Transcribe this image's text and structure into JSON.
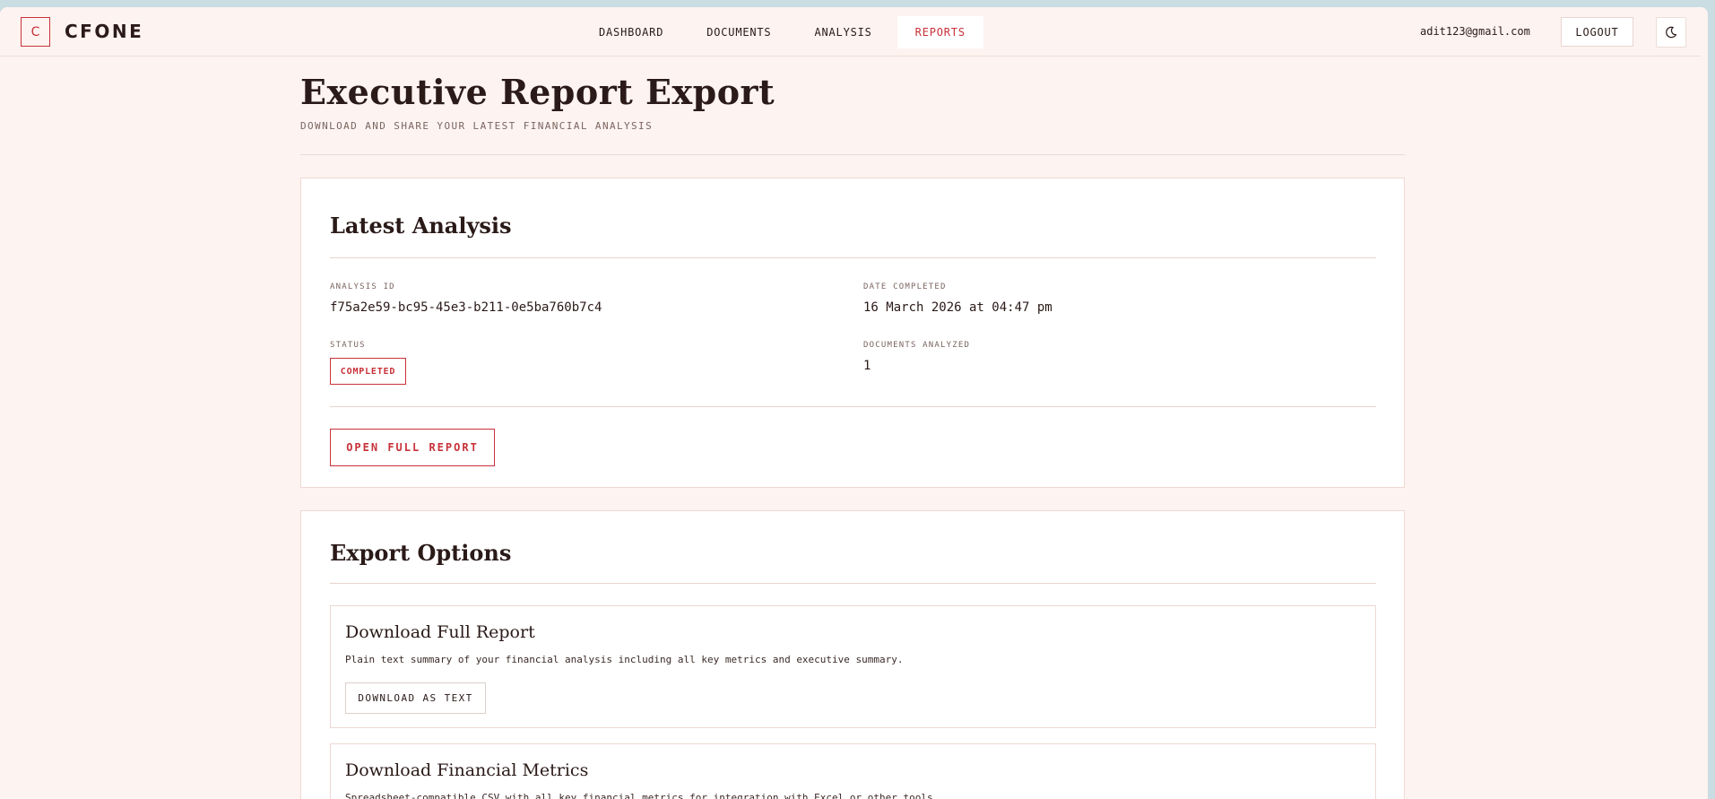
{
  "header": {
    "logo_letter": "C",
    "brand": "CFONE",
    "nav": [
      {
        "label": "DASHBOARD",
        "active": false
      },
      {
        "label": "DOCUMENTS",
        "active": false
      },
      {
        "label": "ANALYSIS",
        "active": false
      },
      {
        "label": "REPORTS",
        "active": true
      }
    ],
    "user_email": "adit123@gmail.com",
    "logout_label": "LOGOUT",
    "theme_icon": "moon-icon"
  },
  "page": {
    "title": "Executive Report Export",
    "subtitle": "DOWNLOAD AND SHARE YOUR LATEST FINANCIAL ANALYSIS"
  },
  "latest_analysis": {
    "title": "Latest Analysis",
    "analysis_id_label": "ANALYSIS ID",
    "analysis_id": "f75a2e59-bc95-45e3-b211-0e5ba760b7c4",
    "date_label": "DATE COMPLETED",
    "date": "16 March 2026 at 04:47 pm",
    "status_label": "STATUS",
    "status": "COMPLETED",
    "documents_label": "DOCUMENTS ANALYZED",
    "documents": "1",
    "open_button": "OPEN FULL REPORT"
  },
  "export_options": {
    "title": "Export Options",
    "options": [
      {
        "title": "Download Full Report",
        "description": "Plain text summary of your financial analysis including all key metrics and executive summary.",
        "button": "DOWNLOAD AS TEXT"
      },
      {
        "title": "Download Financial Metrics",
        "description": "Spreadsheet-compatible CSV with all key financial metrics for integration with Excel or other tools."
      }
    ]
  },
  "colors": {
    "accent": "#c8323a",
    "background": "#fdf3f0",
    "text": "#2a1a18"
  }
}
